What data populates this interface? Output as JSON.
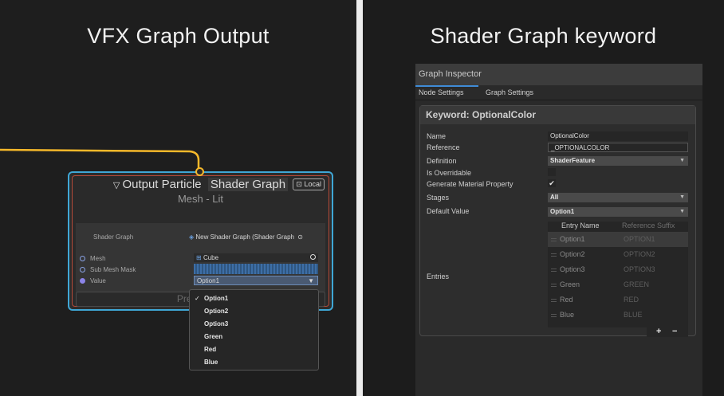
{
  "left_panel": {
    "title": "VFX Graph Output",
    "node": {
      "title_prefix": "Output Particle",
      "title_highlight": "Shader Graph",
      "local_badge": "Local",
      "subtitle": "Mesh - Lit",
      "rows": {
        "shader_graph_label": "Shader Graph",
        "shader_graph_value": "New Shader Graph (Shader Graph",
        "mesh_label": "Mesh",
        "mesh_value": "Cube",
        "sub_mesh_mask_label": "Sub Mesh Mask",
        "value_label": "Value",
        "value_selected": "Option1"
      },
      "press_space": "Press spac"
    },
    "dropdown_menu": [
      "Option1",
      "Option2",
      "Option3",
      "Green",
      "Red",
      "Blue"
    ],
    "dropdown_checked": "Option1",
    "colors": {
      "wire": "#f5b82a",
      "node_border": "#3fa7d6",
      "error_border": "#b54a38"
    }
  },
  "right_panel": {
    "title": "Shader Graph keyword",
    "inspector": {
      "header": "Graph Inspector",
      "tabs": [
        "Node Settings",
        "Graph Settings"
      ],
      "active_tab": "Node Settings",
      "section_title": "Keyword: OptionalColor",
      "properties": {
        "name_label": "Name",
        "name_value": "OptionalColor",
        "reference_label": "Reference",
        "reference_value": "_OPTIONALCOLOR",
        "definition_label": "Definition",
        "definition_value": "ShaderFeature",
        "overridable_label": "Is Overridable",
        "gen_material_label": "Generate Material Property",
        "gen_material_check": "✔",
        "stages_label": "Stages",
        "stages_value": "All",
        "default_label": "Default Value",
        "default_value": "Option1",
        "entries_label": "Entries"
      },
      "entries_headers": {
        "name": "Entry Name",
        "suffix": "Reference Suffix"
      },
      "entries": [
        {
          "name": "Option1",
          "suffix": "OPTION1"
        },
        {
          "name": "Option2",
          "suffix": "OPTION2"
        },
        {
          "name": "Option3",
          "suffix": "OPTION3"
        },
        {
          "name": "Green",
          "suffix": "GREEN"
        },
        {
          "name": "Red",
          "suffix": "RED"
        },
        {
          "name": "Blue",
          "suffix": "BLUE"
        }
      ],
      "add_label": "+",
      "remove_label": "−"
    }
  }
}
